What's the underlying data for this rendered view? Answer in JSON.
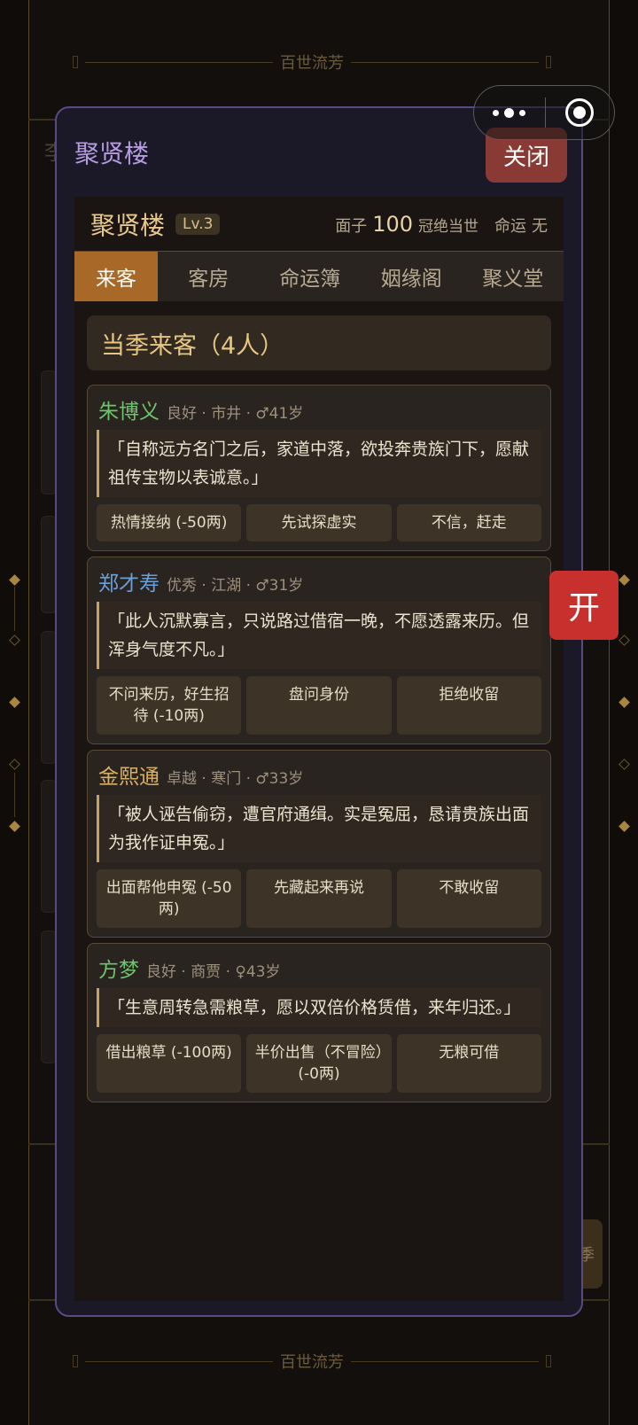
{
  "background": {
    "banner_top": "百世流芳",
    "banner_bottom": "百世流芳",
    "glimpse_char": "李",
    "right_btn_label": "季"
  },
  "capsule": {
    "menu_icon": "more-dots-icon",
    "close_icon": "target-circle-icon"
  },
  "modal": {
    "title": "聚贤楼",
    "close_label": "关闭"
  },
  "hall": {
    "name": "聚贤楼",
    "level": "Lv.3",
    "face_label": "面子",
    "face_value": "100",
    "face_title": "冠绝当世",
    "fate_label": "命运",
    "fate_value": "无"
  },
  "tabs": [
    "来客",
    "客房",
    "命运簿",
    "姻缘阁",
    "聚义堂"
  ],
  "section_title": "当季来客（4人）",
  "guests": [
    {
      "name": "朱博义",
      "name_color": "#6cc46c",
      "meta": "良好 · 市井 · ♂41岁",
      "quote": "「自称远方名门之后，家道中落，欲投奔贵族门下，愿献祖传宝物以表诚意。」",
      "actions": [
        "热情接纳 (-50两)",
        "先试探虚实",
        "不信，赶走"
      ]
    },
    {
      "name": "郑才寿",
      "name_color": "#6aa0d8",
      "meta": "优秀 · 江湖 · ♂31岁",
      "quote": "「此人沉默寡言，只说路过借宿一晚，不愿透露来历。但浑身气度不凡。」",
      "actions": [
        "不问来历，好生招待 (-10两)",
        "盘问身份",
        "拒绝收留"
      ]
    },
    {
      "name": "金熙通",
      "name_color": "#d8b064",
      "meta": "卓越 · 寒门 · ♂33岁",
      "quote": "「被人诬告偷窃，遭官府通缉。实是冤屈，恳请贵族出面为我作证申冤。」",
      "actions": [
        "出面帮他申冤 (-50两)",
        "先藏起来再说",
        "不敢收留"
      ]
    },
    {
      "name": "方梦",
      "name_color": "#6cc46c",
      "meta": "良好 · 商贾 · ♀43岁",
      "quote": "「生意周转急需粮草，愿以双倍价格赁借，来年归还。」",
      "actions": [
        "借出粮草 (-100两)",
        "半价出售（不冒险）(-0两)",
        "无粮可借"
      ]
    }
  ],
  "float_button": "开"
}
